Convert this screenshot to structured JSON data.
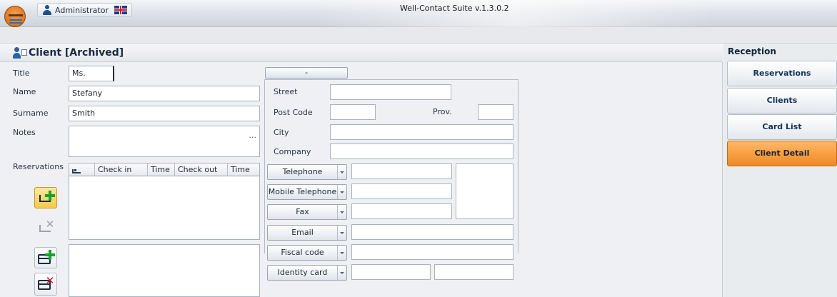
{
  "titlebar": {
    "user": "Administrator",
    "app_title": "Well-Contact Suite v.1.3.0.2"
  },
  "page": {
    "title": "Client [Archived]"
  },
  "client": {
    "title_label": "Title",
    "title_value": "Ms.",
    "name_label": "Name",
    "name_value": "Stefany",
    "surname_label": "Surname",
    "surname_value": "Smith",
    "notes_label": "Notes",
    "notes_value": "",
    "notes_more": "...",
    "reservations_label": "Reservations"
  },
  "reservations_table": {
    "columns": [
      "Check in",
      "Time",
      "Check out",
      "Time"
    ],
    "rows": []
  },
  "address": {
    "toggle_label": "-",
    "street_label": "Street",
    "street_value": "",
    "postcode_label": "Post Code",
    "postcode_value": "",
    "prov_label": "Prov.",
    "prov_value": "",
    "city_label": "City",
    "city_value": "",
    "company_label": "Company",
    "company_value": ""
  },
  "contacts": {
    "telephone": "Telephone",
    "mobile": "Mobile Telephone",
    "fax": "Fax",
    "email": "Email",
    "fiscal": "Fiscal code",
    "identity": "Identity card"
  },
  "sidebar": {
    "title": "Reception",
    "items": [
      {
        "label": "Reservations",
        "active": false
      },
      {
        "label": "Clients",
        "active": false
      },
      {
        "label": "Card List",
        "active": false
      },
      {
        "label": "Client Detail",
        "active": true
      }
    ]
  },
  "colors": {
    "active_accent": "#f8a043",
    "add_green": "#1aa12a",
    "delete_red": "#e0151f",
    "heading": "#1a2a40"
  },
  "icons": [
    "app-logo-icon",
    "user-icon",
    "flag-uk-icon",
    "client-card-icon",
    "bed-icon",
    "add-reservation-icon",
    "remove-reservation-icon",
    "add-card-icon",
    "delete-card-icon",
    "chevron-down-icon"
  ]
}
